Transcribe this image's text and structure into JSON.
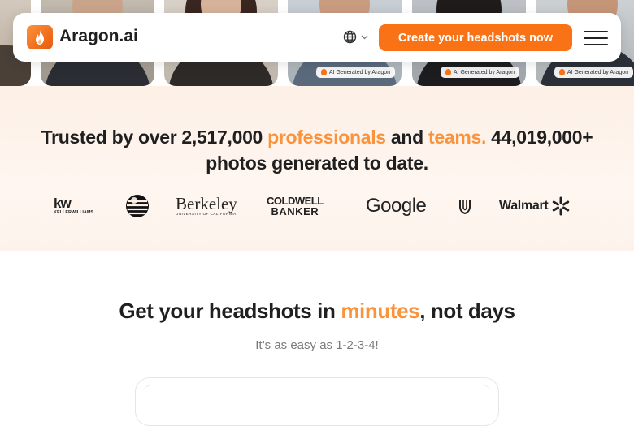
{
  "nav": {
    "brand": "Aragon.ai",
    "cta_label": "Create your headshots now",
    "language_icon": "globe-icon",
    "menu_icon": "hamburger-icon"
  },
  "photos": {
    "badge_text": "AI Generated by Aragon"
  },
  "trusted": {
    "line1_part1": "Trusted by over 2,517,000",
    "line1_highlight1": "professionals",
    "line1_part2": "and",
    "line1_highlight2": "teams.",
    "line1_part3": "44,019,000+",
    "line2": "photos generated to date."
  },
  "logos": {
    "kw_top": "kw",
    "kw_bottom": "KELLERWILLIAMS.",
    "berkeley": "Berkeley",
    "berkeley_sub": "UNIVERSITY OF CALIFORNIA",
    "coldwell_top": "COLDWELL",
    "coldwell_bottom": "BANKER",
    "google": "Google",
    "walmart": "Walmart"
  },
  "steps": {
    "title_part1": "Get your headshots in",
    "title_highlight": "minutes",
    "title_part2": ", not days",
    "subtitle": "It’s as easy as 1-2-3-4!"
  },
  "colors": {
    "accent": "#f97316",
    "accent_light": "#fb923c",
    "band_bg": "#fdf0e6"
  }
}
